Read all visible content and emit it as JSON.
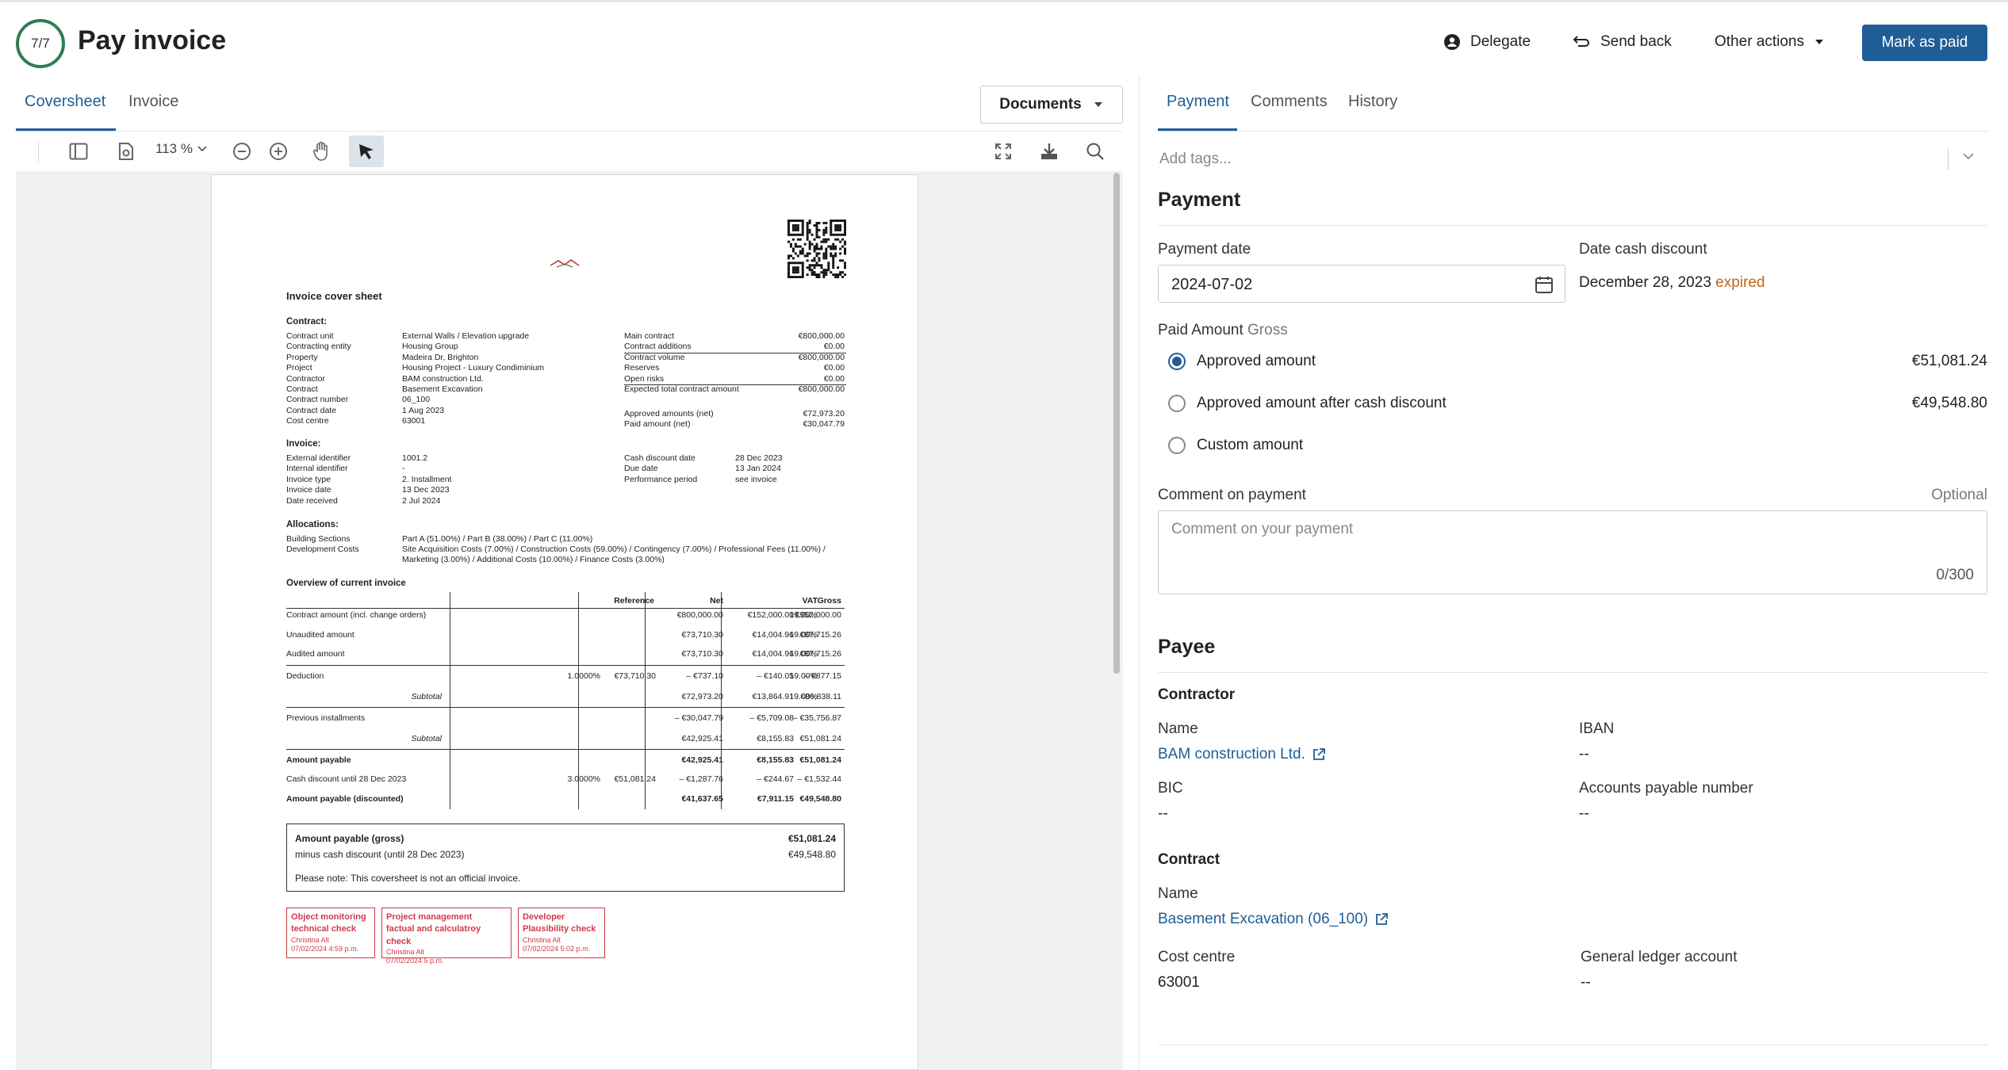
{
  "header": {
    "step": "7/7",
    "title": "Pay invoice",
    "delegate": "Delegate",
    "send_back": "Send back",
    "other_actions": "Other actions",
    "mark_paid": "Mark as paid"
  },
  "left_tabs": [
    "Coversheet",
    "Invoice"
  ],
  "documents_button": "Documents",
  "toolbar": {
    "zoom": "113 %"
  },
  "doc": {
    "title": "Invoice cover sheet",
    "contract_heading": "Contract:",
    "contract_labels": [
      "Contract unit",
      "Contracting entity",
      "Property",
      "Project",
      "Contractor",
      "Contract",
      "Contract number",
      "Contract date",
      "Cost centre"
    ],
    "contract_values": [
      "External Walls / Elevation upgrade",
      "Housing Group",
      "Madeira Dr, Brighton",
      "Housing Project - Luxury Condiminium",
      "BAM construction Ltd.",
      "Basement Excavation",
      "06_100",
      "1 Aug 2023",
      "63001"
    ],
    "contract_right_labels": [
      "Main contract",
      "Contract additions",
      "Contract volume",
      "Reserves",
      "Open risks",
      "Expected total contract amount",
      "",
      "Approved amounts (net)",
      "Paid amount (net)"
    ],
    "contract_right_values": [
      "€800,000.00",
      "€0.00",
      "€800,000.00",
      "€0.00",
      "€0.00",
      "€800,000.00",
      "",
      "€72,973.20",
      "€30,047.79"
    ],
    "invoice_heading": "Invoice:",
    "invoice_labels": [
      "External identifier",
      "Internal identifier",
      "Invoice type",
      "Invoice date",
      "Date received"
    ],
    "invoice_values": [
      "1001.2",
      "-",
      "2. Installment",
      "13 Dec 2023",
      "2 Jul 2024"
    ],
    "invoice_right_labels": [
      "Cash discount date",
      "Due date",
      "Performance period"
    ],
    "invoice_right_values": [
      "28 Dec 2023",
      "13 Jan 2024",
      "see invoice"
    ],
    "alloc_heading": "Allocations:",
    "alloc_labels": [
      "Building Sections",
      "Development Costs"
    ],
    "alloc_values": [
      "Part A (51.00%) / Part B (38.00%) / Part C (11.00%)",
      "Site Acquisition Costs (7.00%) / Construction Costs (59.00%) / Contingency (7.00%) / Professional Fees (11.00%) /",
      "Marketing (3.00%) / Additional Costs (10.00%) / Finance Costs (3.00%)"
    ],
    "overview_heading": "Overview of current invoice",
    "table_headers": [
      "Reference",
      "Net",
      "VAT",
      "Gross"
    ],
    "table_rows": [
      {
        "label": "Contract amount (incl. change orders)",
        "r1": "",
        "r2": "",
        "net": "€800,000.00",
        "vat": "€152,000.00",
        "pct": "19.00%",
        "gross": "€952,000.00",
        "bold": false
      },
      {
        "label": "Unaudited amount",
        "r1": "",
        "r2": "",
        "net": "€73,710.30",
        "vat": "€14,004.96",
        "pct": "19.00%",
        "gross": "€87,715.26",
        "bold": false
      },
      {
        "label": "Audited amount",
        "r1": "",
        "r2": "",
        "net": "€73,710.30",
        "vat": "€14,004.96",
        "pct": "19.00%",
        "gross": "€87,715.26",
        "bold": false
      },
      {
        "label": "Deduction",
        "r1": "1.0000%",
        "r2": "€73,710.30",
        "net": "– €737.10",
        "vat": "– €140.05",
        "pct": "19.00%",
        "gross": "– €877.15",
        "bold": false
      },
      {
        "label": "Subtotal",
        "r1": "",
        "r2": "",
        "net": "€72,973.20",
        "vat": "€13,864.91",
        "pct": "19.00%",
        "gross": "€86,838.11",
        "bold": false,
        "sub": true
      },
      {
        "label": "Previous installments",
        "r1": "",
        "r2": "",
        "net": "– €30,047.79",
        "vat": "– €5,709.08",
        "pct": "",
        "gross": "– €35,756.87",
        "bold": false
      },
      {
        "label": "Subtotal",
        "r1": "",
        "r2": "",
        "net": "€42,925.41",
        "vat": "€8,155.83",
        "pct": "",
        "gross": "€51,081.24",
        "bold": false,
        "sub": true
      },
      {
        "label": "Amount payable",
        "r1": "",
        "r2": "",
        "net": "€42,925.41",
        "vat": "€8,155.83",
        "pct": "",
        "gross": "€51,081.24",
        "bold": true
      },
      {
        "label": "Cash discount until 28 Dec 2023",
        "r1": "3.0000%",
        "r2": "€51,081.24",
        "net": "– €1,287.76",
        "vat": "– €244.67",
        "pct": "",
        "gross": "– €1,532.44",
        "bold": false
      },
      {
        "label": "Amount payable (discounted)",
        "r1": "",
        "r2": "",
        "net": "€41,637.65",
        "vat": "€7,911.15",
        "pct": "",
        "gross": "€49,548.80",
        "bold": true
      }
    ],
    "box": {
      "l1": "Amount payable (gross)",
      "v1": "€51,081.24",
      "l2": "minus cash discount (until 28 Dec 2023)",
      "v2": "€49,548.80",
      "note": "Please note: This coversheet is not an official invoice."
    },
    "stamps": [
      {
        "t1": "Object monitoring",
        "t2": "technical check",
        "who": "Christina Alt",
        "when": "07/02/2024 4:59 p.m."
      },
      {
        "t1": "Project management",
        "t2": "factual and calculatroy check",
        "who": "Christina Alt",
        "when": "07/02/2024 5 p.m."
      },
      {
        "t1": "Developer",
        "t2": "Plausibility check",
        "who": "Christina Alt",
        "when": "07/02/2024 5:02 p.m."
      }
    ]
  },
  "right_tabs": [
    "Payment",
    "Comments",
    "History"
  ],
  "tags_placeholder": "Add tags...",
  "payment": {
    "heading": "Payment",
    "date_label": "Payment date",
    "date_value": "2024-07-02",
    "cash_label": "Date cash discount",
    "cash_value": "December 28, 2023",
    "cash_status": "expired",
    "paid_label": "Paid Amount",
    "paid_sub": "Gross",
    "options": [
      {
        "label": "Approved amount",
        "value": "€51,081.24"
      },
      {
        "label": "Approved amount after cash discount",
        "value": "€49,548.80"
      },
      {
        "label": "Custom amount",
        "value": ""
      }
    ],
    "comment_label": "Comment on payment",
    "comment_optional": "Optional",
    "comment_placeholder": "Comment on your payment",
    "comment_count": "0/300"
  },
  "payee": {
    "heading": "Payee",
    "contractor_heading": "Contractor",
    "name_label": "Name",
    "name_value": "BAM construction Ltd.",
    "iban_label": "IBAN",
    "iban_value": "--",
    "bic_label": "BIC",
    "bic_value": "--",
    "ap_label": "Accounts payable number",
    "ap_value": "--",
    "contract_heading": "Contract",
    "contract_name_label": "Name",
    "contract_name_value": "Basement Excavation (06_100)",
    "cost_label": "Cost centre",
    "cost_value": "63001",
    "gl_label": "General ledger account",
    "gl_value": "--"
  },
  "colors": {
    "accent": "#1f5d96",
    "progress": "#2f7d55",
    "expired": "#c0651a",
    "stamp": "#d23a4a"
  }
}
